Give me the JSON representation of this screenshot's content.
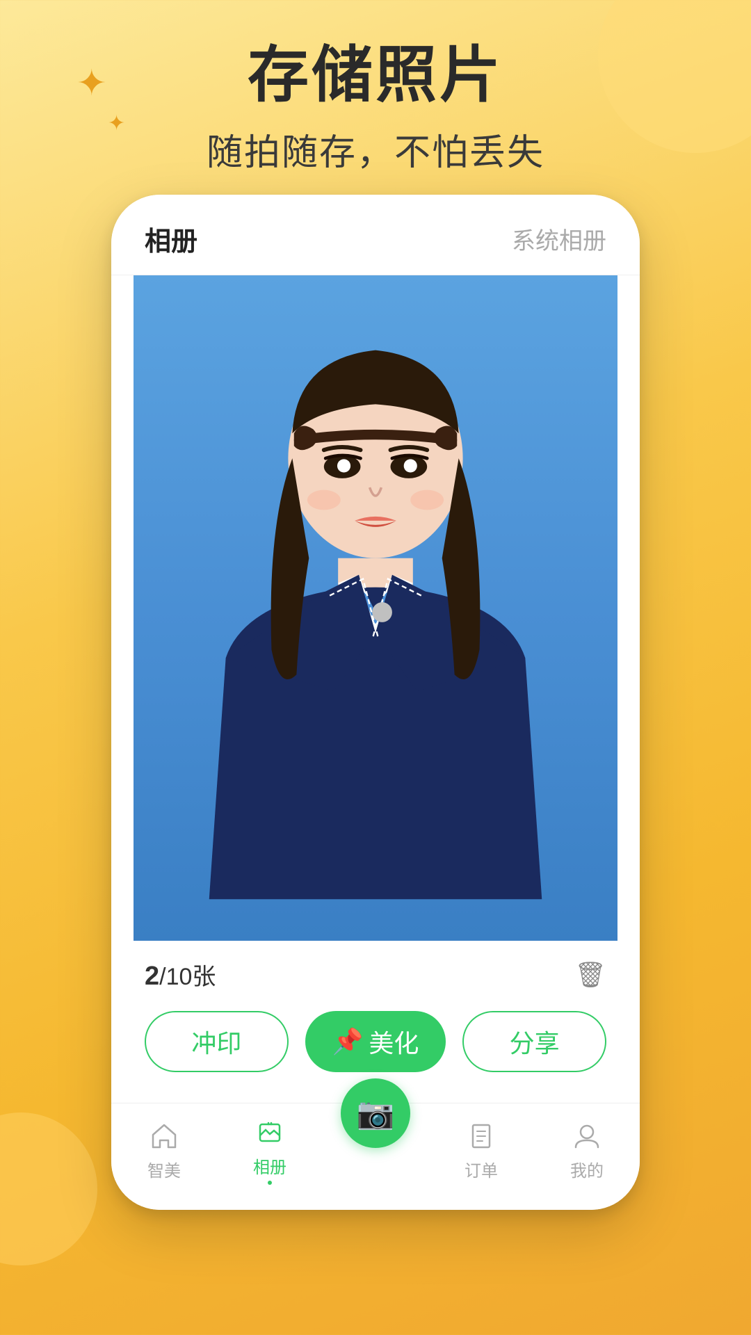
{
  "background": {
    "color_start": "#fde99a",
    "color_end": "#f0a830"
  },
  "header": {
    "main_title": "存储照片",
    "sub_title": "随拍随存，不怕丢失"
  },
  "phone": {
    "tabs": [
      {
        "label": "相册",
        "active": true
      },
      {
        "label": "系统相册",
        "active": false
      }
    ],
    "photo_count": {
      "current": "2",
      "total": "10",
      "unit": "张",
      "separator": "/"
    },
    "action_buttons": [
      {
        "label": "冲印",
        "type": "outline"
      },
      {
        "label": "美化",
        "type": "solid",
        "icon": "📌"
      },
      {
        "label": "分享",
        "type": "outline"
      }
    ],
    "bottom_nav": [
      {
        "label": "智美",
        "icon": "home",
        "active": false
      },
      {
        "label": "相册",
        "icon": "album",
        "active": true
      },
      {
        "label": "",
        "icon": "camera_fab",
        "active": false,
        "is_fab": true
      },
      {
        "label": "订单",
        "icon": "order",
        "active": false
      },
      {
        "label": "我的",
        "icon": "profile",
        "active": false
      }
    ]
  },
  "icons": {
    "star_big": "✦",
    "star_small": "✦",
    "trash": "🗑",
    "camera": "📷",
    "pin": "📌"
  }
}
